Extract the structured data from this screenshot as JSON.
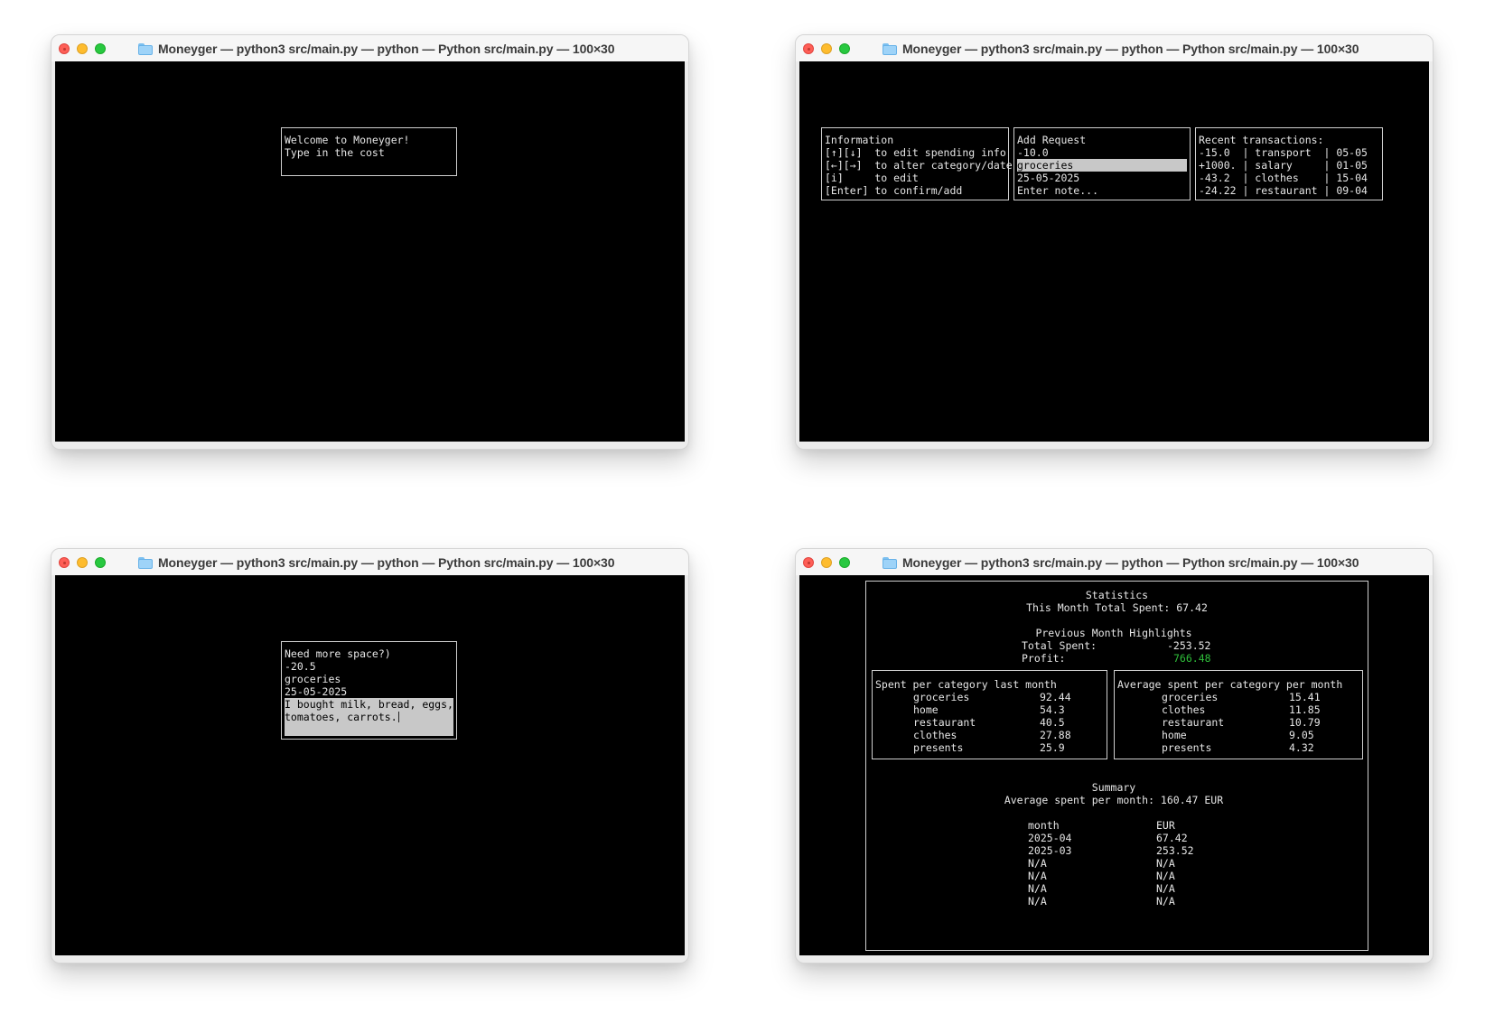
{
  "window_title": "Moneyger — python3 src/main.py — python — Python src/main.py — 100×30",
  "colors": {
    "terminal_bg": "#000000",
    "terminal_fg": "#e6e6e6",
    "highlight_bg": "#c8c8c8",
    "profit_green": "#2fbf3a"
  },
  "window1": {
    "welcome": {
      "line1": "Welcome to Moneyger!",
      "line2": "Type in the cost"
    }
  },
  "window2": {
    "info": {
      "title": "Information",
      "line1": "[↑][↓]  to edit spending info",
      "line2": "[←][→]  to alter category/date",
      "line3": "[i]     to edit",
      "line4": "[Enter] to confirm/add"
    },
    "add_request": {
      "title": "Add Request",
      "amount": "-10.0",
      "category": "groceries",
      "date": "25-05-2025",
      "note_placeholder": "Enter note..."
    },
    "recent": {
      "title": "Recent transactions:",
      "rows": [
        "-15.0  | transport  | 05-05",
        "+1000. | salary     | 01-05",
        "-43.2  | clothes    | 15-04",
        "-24.22 | restaurant | 09-04"
      ]
    }
  },
  "window3": {
    "title": "Need more space?)",
    "amount": "-20.5",
    "category": "groceries",
    "date": "25-05-2025",
    "note_line1": "I bought milk, bread, eggs,",
    "note_line2": "tomatoes, carrots."
  },
  "window4": {
    "heading": "Statistics",
    "this_month": "This Month Total Spent: 67.42",
    "prev_heading": "Previous Month Highlights",
    "total_spent_label": "Total Spent:",
    "total_spent_value": "-253.52",
    "profit_label": "Profit:",
    "profit_value": "766.48",
    "spent_last_month": {
      "title": "Spent per category last month",
      "rows": [
        {
          "category": "groceries",
          "value": "92.44"
        },
        {
          "category": "home",
          "value": "54.3"
        },
        {
          "category": "restaurant",
          "value": "40.5"
        },
        {
          "category": "clothes",
          "value": "27.88"
        },
        {
          "category": "presents",
          "value": "25.9"
        }
      ]
    },
    "average_per_month": {
      "title": "Average spent per category per month",
      "rows": [
        {
          "category": "groceries",
          "value": "15.41"
        },
        {
          "category": "clothes",
          "value": "11.85"
        },
        {
          "category": "restaurant",
          "value": "10.79"
        },
        {
          "category": "home",
          "value": "9.05"
        },
        {
          "category": "presents",
          "value": "4.32"
        }
      ]
    },
    "summary": {
      "title": "Summary",
      "average_line": "Average spent per month: 160.47 EUR",
      "col_month": "month",
      "col_eur": "EUR",
      "rows": [
        {
          "month": "2025-04",
          "eur": "67.42"
        },
        {
          "month": "2025-03",
          "eur": "253.52"
        },
        {
          "month": "N/A",
          "eur": "N/A"
        },
        {
          "month": "N/A",
          "eur": "N/A"
        },
        {
          "month": "N/A",
          "eur": "N/A"
        },
        {
          "month": "N/A",
          "eur": "N/A"
        }
      ]
    }
  }
}
